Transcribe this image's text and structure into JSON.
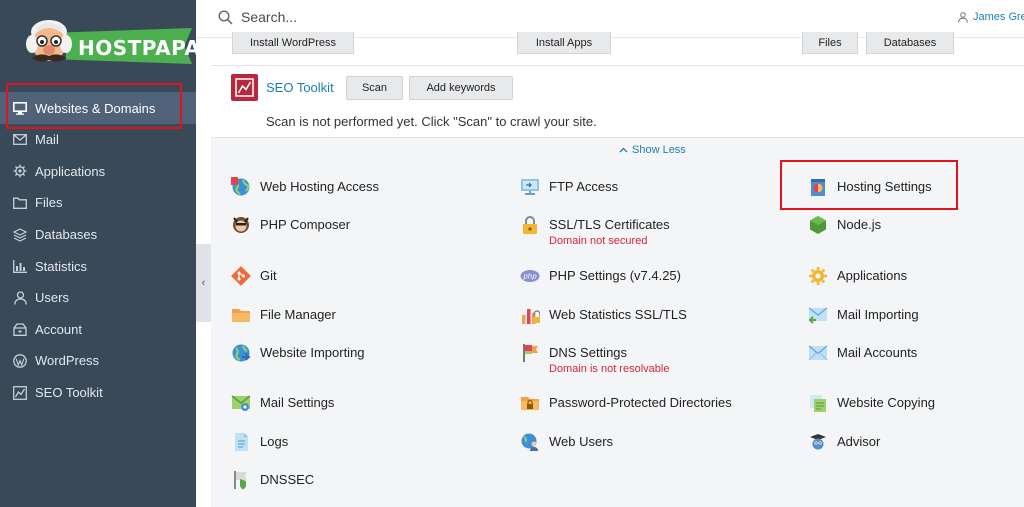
{
  "brand": {
    "name": "HOSTPAPA"
  },
  "sidebar": {
    "items": [
      {
        "label": "Websites & Domains",
        "icon": "monitor-icon",
        "active": true
      },
      {
        "label": "Mail",
        "icon": "mail-icon"
      },
      {
        "label": "Applications",
        "icon": "gear-icon"
      },
      {
        "label": "Files",
        "icon": "folder-icon"
      },
      {
        "label": "Databases",
        "icon": "database-icon"
      },
      {
        "label": "Statistics",
        "icon": "bar-chart-icon"
      },
      {
        "label": "Users",
        "icon": "user-icon"
      },
      {
        "label": "Account",
        "icon": "account-icon"
      },
      {
        "label": "WordPress",
        "icon": "wordpress-icon"
      },
      {
        "label": "SEO Toolkit",
        "icon": "seo-chart-icon"
      }
    ],
    "collapse_glyph": "‹"
  },
  "topbar": {
    "search_placeholder": "Search...",
    "user_name": "James Gre"
  },
  "quick_buttons": {
    "install_wordpress": "Install WordPress",
    "install_apps": "Install Apps",
    "files": "Files",
    "databases": "Databases"
  },
  "seo": {
    "title": "SEO Toolkit",
    "scan_label": "Scan",
    "add_keywords_label": "Add keywords",
    "description": "Scan is not performed yet. Click \"Scan\" to crawl your site."
  },
  "show_less": "Show Less",
  "tools": {
    "col1": [
      {
        "label": "Web Hosting Access",
        "icon": "globe-icon"
      },
      {
        "label": "PHP Composer",
        "icon": "composer-icon"
      },
      {
        "label": "Git",
        "icon": "git-icon"
      },
      {
        "label": "File Manager",
        "icon": "file-manager-icon"
      },
      {
        "label": "Website Importing",
        "icon": "website-importing-icon"
      },
      {
        "label": "Mail Settings",
        "icon": "mail-settings-icon"
      },
      {
        "label": "Logs",
        "icon": "logs-icon"
      },
      {
        "label": "DNSSEC",
        "icon": "dnssec-icon"
      }
    ],
    "col2": [
      {
        "label": "FTP Access",
        "icon": "ftp-icon"
      },
      {
        "label": "SSL/TLS Certificates",
        "icon": "lock-icon",
        "status": "Domain not secured"
      },
      {
        "label": "PHP Settings (v7.4.25)",
        "icon": "php-icon"
      },
      {
        "label": "Web Statistics SSL/TLS",
        "icon": "web-statistics-icon"
      },
      {
        "label": "DNS Settings",
        "icon": "dns-icon",
        "status": "Domain is not resolvable"
      },
      {
        "label": "Password-Protected Directories",
        "icon": "protected-folder-icon"
      },
      {
        "label": "Web Users",
        "icon": "web-users-icon"
      }
    ],
    "col3": [
      {
        "label": "Hosting Settings",
        "icon": "hosting-settings-icon"
      },
      {
        "label": "Node.js",
        "icon": "nodejs-icon"
      },
      {
        "label": "Applications",
        "icon": "applications-icon"
      },
      {
        "label": "Mail Importing",
        "icon": "mail-importing-icon"
      },
      {
        "label": "Mail Accounts",
        "icon": "mail-accounts-icon"
      },
      {
        "label": "Website Copying",
        "icon": "website-copying-icon"
      },
      {
        "label": "Advisor",
        "icon": "advisor-icon"
      }
    ]
  },
  "colors": {
    "sidebar_bg": "#394958",
    "sidebar_active": "#50627a",
    "link": "#1f7db5",
    "highlight": "#e0141e",
    "warning_text": "#d4263a",
    "brand_green": "#4caf50"
  }
}
